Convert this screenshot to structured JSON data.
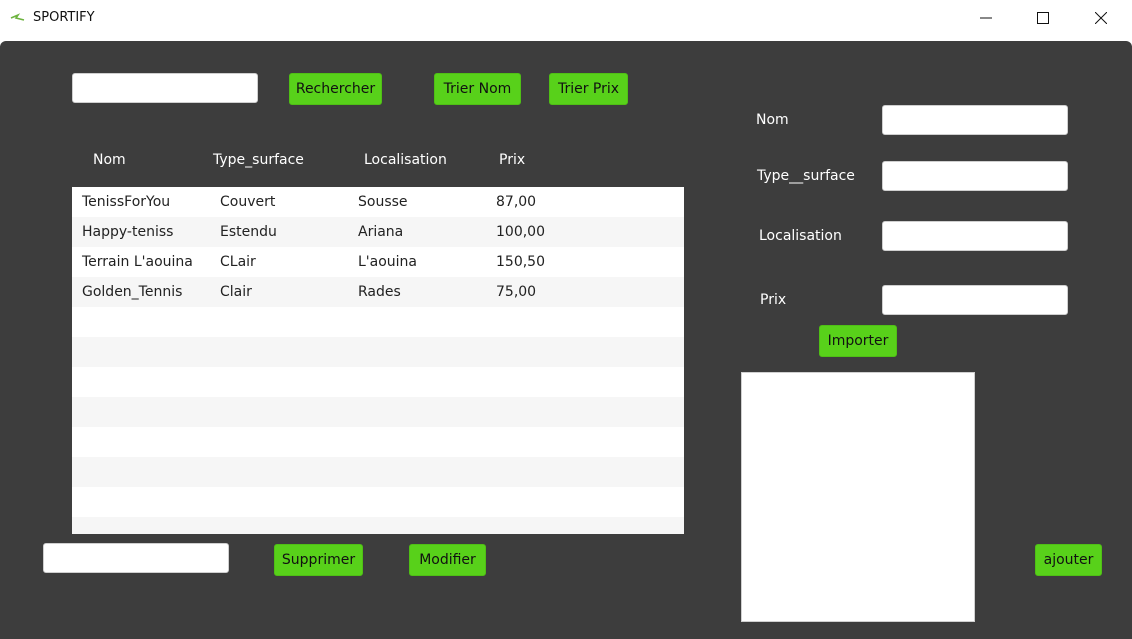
{
  "window": {
    "title": "SPORTIFY",
    "controls": [
      "minimize-icon",
      "maximize-icon",
      "close-icon"
    ]
  },
  "toolbar": {
    "search_value": "",
    "search_label": "Rechercher",
    "sort_name_label": "Trier Nom",
    "sort_price_label": "Trier Prix"
  },
  "table": {
    "columns": [
      "Nom",
      "Type_surface",
      "Localisation",
      "Prix"
    ],
    "rows": [
      [
        "TenissForYou",
        "Couvert",
        "Sousse",
        "87,00"
      ],
      [
        "Happy-teniss",
        "Estendu",
        "Ariana",
        "100,00"
      ],
      [
        "Terrain L'aouina",
        "CLair",
        "L'aouina",
        "150,50"
      ],
      [
        "Golden_Tennis",
        "Clair",
        "Rades",
        "75,00"
      ]
    ]
  },
  "actions": {
    "id_value": "",
    "delete_label": "Supprimer",
    "modify_label": "Modifier"
  },
  "form": {
    "nom_label": "Nom",
    "type_label": "Type__surface",
    "localisation_label": "Localisation",
    "prix_label": "Prix",
    "import_label": "Importer",
    "add_label": "ajouter"
  },
  "colors": {
    "accent": "#58d11a",
    "panel_bg": "#3d3d3d"
  }
}
